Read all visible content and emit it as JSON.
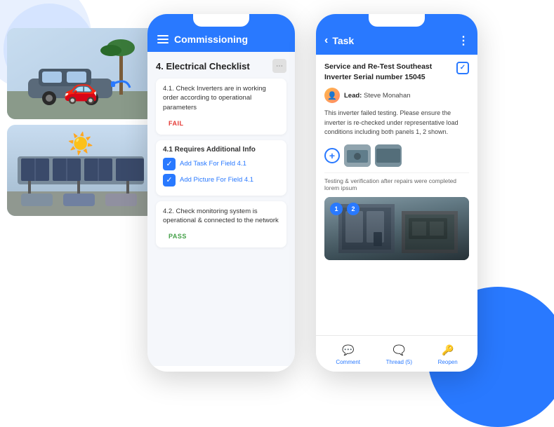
{
  "app": {
    "title": "Commissioning App"
  },
  "decorative": {
    "bg_circle_top_left_color": "#e8f0fe",
    "bg_circle_bottom_right_color": "#2979ff"
  },
  "left_phone": {
    "header": {
      "menu_icon": "hamburger-icon",
      "title": "Commissioning"
    },
    "section": {
      "title": "4. Electrical Checklist",
      "items": [
        {
          "text": "4.1. Check Inverters are in working order according to operational parameters",
          "status": "FAIL",
          "status_type": "fail"
        },
        {
          "text": "4.2. Check monitoring system is operational & connected to the network",
          "status": "PASS",
          "status_type": "pass"
        }
      ],
      "requires_info": {
        "title": "4.1 Requires Additional Info",
        "actions": [
          {
            "label": "Add Task For Field 4.1",
            "icon": "+"
          },
          {
            "label": "Add Picture For Field 4.1",
            "icon": "+"
          }
        ]
      }
    }
  },
  "right_phone": {
    "header": {
      "back_label": "Task",
      "more_icon": "three-dots-icon"
    },
    "task": {
      "title": "Service and Re-Test Southeast Inverter Serial number 15045",
      "lead_label": "Lead:",
      "lead_name": "Steve Monahan",
      "description": "This inverter failed testing. Please  ensure the inverter is re-checked under representative load conditions including both panels 1, 2 shown.",
      "testing_note": "Testing & verification after repairs were completed lorem ipsum",
      "image_badges": [
        "1",
        "2"
      ]
    },
    "bottom_nav": [
      {
        "icon": "💬",
        "label": "Comment",
        "name": "comment-nav"
      },
      {
        "icon": "🗨️",
        "label": "Thread (5)",
        "name": "thread-nav"
      },
      {
        "icon": "🔑",
        "label": "Reopen",
        "name": "reopen-nav"
      }
    ]
  }
}
